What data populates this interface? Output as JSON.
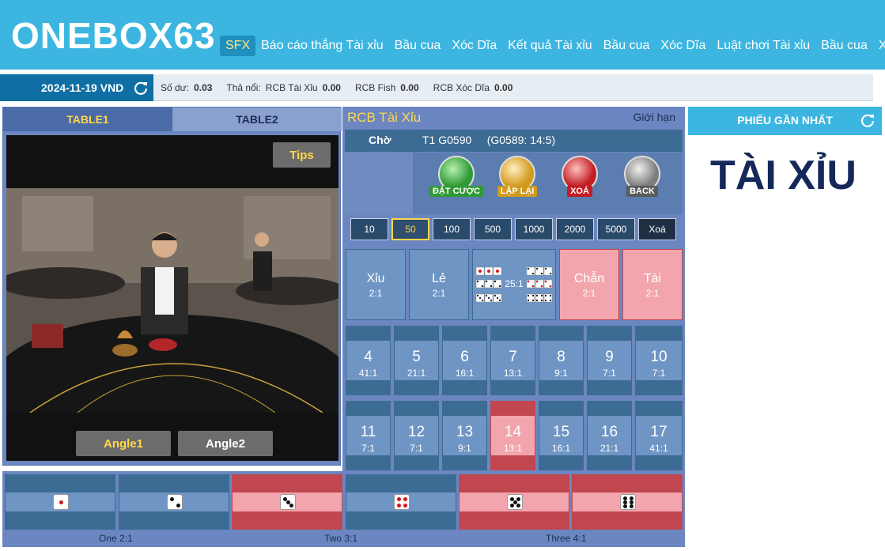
{
  "header": {
    "logo": "ONEBOX63",
    "nav": [
      {
        "label": "SFX",
        "active": true
      },
      {
        "label": "Báo cáo thắng Tài xỉu"
      },
      {
        "label": "Bầu cua"
      },
      {
        "label": "Xóc Dĩa"
      },
      {
        "label": "Kết quả Tài xỉu"
      },
      {
        "label": "Bầu cua"
      },
      {
        "label": "Xóc Dĩa"
      },
      {
        "label": "Luật chơi Tài xỉu"
      },
      {
        "label": "Bầu cua"
      },
      {
        "label": "Xóc Dĩa"
      }
    ]
  },
  "infobar": {
    "date": "2024-11-19 VND",
    "balance_label": "Số dư:",
    "balance_value": "0.03",
    "float_label": "Thả nổi:",
    "rcb_taixiu_label": "RCB Tài Xỉu",
    "rcb_taixiu_value": "0.00",
    "rcb_fish_label": "RCB Fish",
    "rcb_fish_value": "0.00",
    "rcb_xocdia_label": "RCB Xóc Dĩa",
    "rcb_xocdia_value": "0.00"
  },
  "video": {
    "tab1": "TABLE1",
    "tab2": "TABLE2",
    "tips": "Tips",
    "angle1": "Angle1",
    "angle2": "Angle2"
  },
  "betting": {
    "table_name": "RCB Tài Xỉu",
    "limit": "Giới hạn",
    "status": "Chờ",
    "game_id": "T1 G0590",
    "game_extra": "(G0589: 14:5)",
    "actions": [
      {
        "label": "ĐẶT CƯỢC",
        "icon": "place-bet-icon",
        "color": "#2f9a35"
      },
      {
        "label": "LẶP LẠI",
        "icon": "repeat-icon",
        "color": "#d29a1c"
      },
      {
        "label": "XOÁ",
        "icon": "delete-icon",
        "color": "#c21d22"
      },
      {
        "label": "BACK",
        "icon": "back-icon",
        "color": "#7c7c7c"
      }
    ],
    "chips": [
      {
        "label": "10"
      },
      {
        "label": "50",
        "selected": true
      },
      {
        "label": "100"
      },
      {
        "label": "500"
      },
      {
        "label": "1000"
      },
      {
        "label": "2000"
      },
      {
        "label": "5000"
      },
      {
        "label": "Xoá",
        "clear": true
      }
    ],
    "top_bets": [
      {
        "name": "Xỉu",
        "odds": "2:1",
        "red": false
      },
      {
        "name": "Lẻ",
        "odds": "2:1",
        "red": false
      },
      {
        "name": "",
        "odds": "25:1",
        "red": false
      },
      {
        "name": "Chẵn",
        "odds": "2:1",
        "red": true
      },
      {
        "name": "Tài",
        "odds": "2:1",
        "red": true
      }
    ],
    "totals_row1": [
      {
        "name": "4",
        "odds": "41:1"
      },
      {
        "name": "5",
        "odds": "21:1"
      },
      {
        "name": "6",
        "odds": "16:1"
      },
      {
        "name": "7",
        "odds": "13:1"
      },
      {
        "name": "8",
        "odds": "9:1"
      },
      {
        "name": "9",
        "odds": "7:1"
      },
      {
        "name": "10",
        "odds": "7:1"
      }
    ],
    "totals_row2": [
      {
        "name": "11",
        "odds": "7:1"
      },
      {
        "name": "12",
        "odds": "7:1"
      },
      {
        "name": "13",
        "odds": "9:1"
      },
      {
        "name": "14",
        "odds": "13:1",
        "red": true
      },
      {
        "name": "15",
        "odds": "16:1"
      },
      {
        "name": "16",
        "odds": "21:1"
      },
      {
        "name": "17",
        "odds": "41:1"
      }
    ]
  },
  "singles": {
    "dice": [
      1,
      2,
      3,
      4,
      5,
      6
    ],
    "red": [
      false,
      false,
      true,
      false,
      true,
      true
    ],
    "one": "One 2:1",
    "two": "Two 3:1",
    "three": "Three 4:1"
  },
  "right": {
    "title": "PHIẾU GẦN NHẤT",
    "big": "TÀI XỈU"
  },
  "colors": {
    "header": "#3cb6e0",
    "panel": "#6b86c0",
    "red_cell": "#f3a5ae",
    "blue_cell": "#6f95c4"
  }
}
